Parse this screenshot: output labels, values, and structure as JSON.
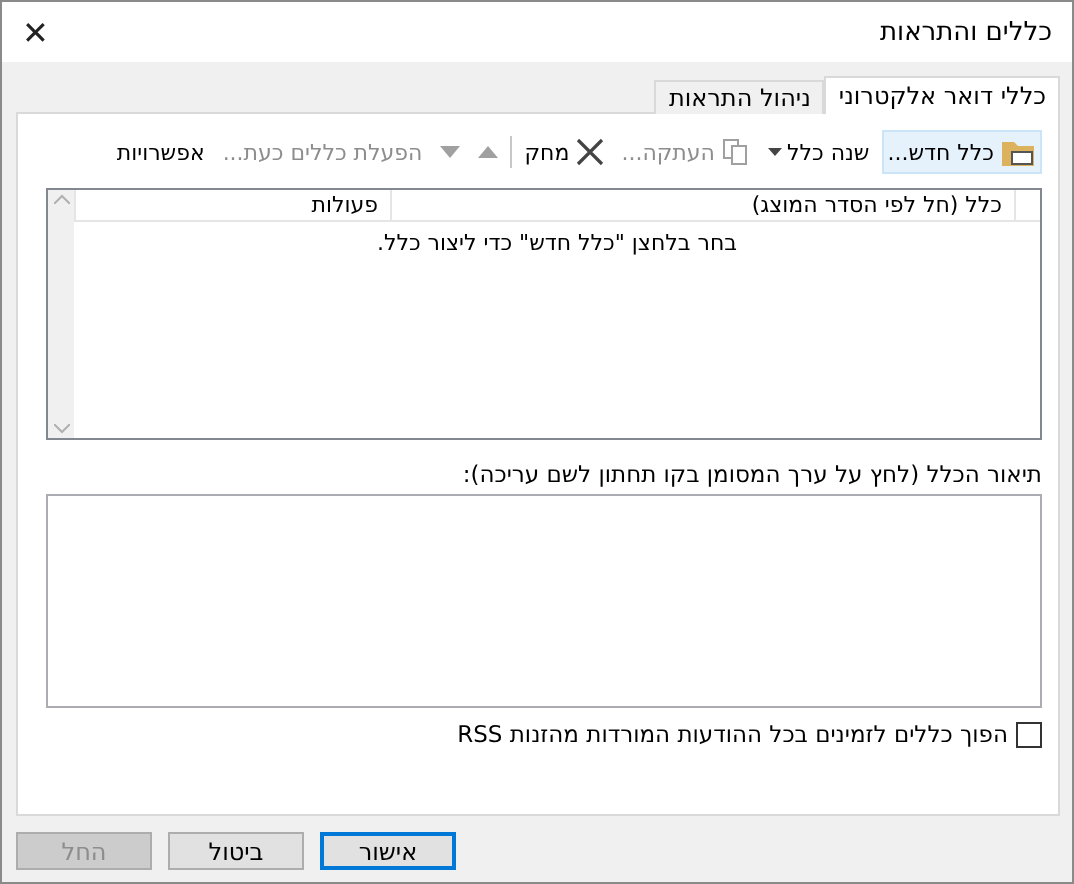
{
  "window": {
    "title": "כללים והתראות",
    "close": "✕"
  },
  "tabs": [
    {
      "label": "כללי דואר אלקטרוני",
      "selected": true
    },
    {
      "label": "ניהול התראות",
      "selected": false
    }
  ],
  "toolbar": [
    {
      "kind": "new",
      "label": "כלל חדש...",
      "disabled": false
    },
    {
      "kind": "change",
      "label": "שנה כלל",
      "disabled": false
    },
    {
      "kind": "copy",
      "label": "העתקה...",
      "disabled": true
    },
    {
      "kind": "delete",
      "label": "מחק",
      "disabled": false
    },
    {
      "kind": "separator"
    },
    {
      "kind": "up",
      "disabled": true
    },
    {
      "kind": "down",
      "disabled": true
    },
    {
      "kind": "run",
      "label": "הפעלת כללים כעת...",
      "disabled": true
    },
    {
      "kind": "options",
      "label": "אפשרויות",
      "disabled": false
    }
  ],
  "rules_table": {
    "columns": [
      "כלל (חל לפי הסדר המוצג)",
      "פעולות"
    ],
    "empty_message": "בחר בלחצן \"כלל חדש\" כדי ליצור כלל."
  },
  "description": {
    "label": "תיאור הכלל (לחץ על ערך המסומן בקו תחתון לשם עריכה):"
  },
  "rss_checkbox": {
    "label": "הפוך כללים לזמינים בכל ההודעות המורדות מהזנות RSS",
    "checked": false
  },
  "buttons": [
    {
      "label": "אישור",
      "default": true,
      "disabled": false
    },
    {
      "label": "ביטול",
      "default": false,
      "disabled": false
    },
    {
      "label": "החל",
      "default": false,
      "disabled": true
    }
  ]
}
